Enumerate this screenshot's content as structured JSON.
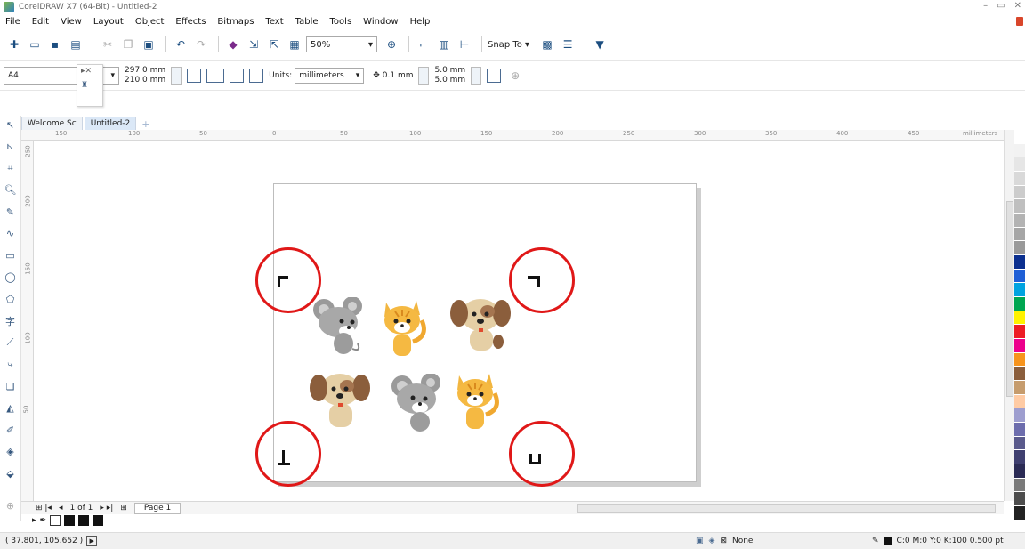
{
  "window": {
    "title": "CorelDRAW X7 (64-Bit) - Untitled-2",
    "controls": [
      "–",
      "▭",
      "✕"
    ]
  },
  "menu": [
    "File",
    "Edit",
    "View",
    "Layout",
    "Object",
    "Effects",
    "Bitmaps",
    "Text",
    "Table",
    "Tools",
    "Window",
    "Help"
  ],
  "toolbar": {
    "zoom": "50%",
    "snap_to": "Snap To"
  },
  "property_bar": {
    "paper": "A4",
    "width": "297.0 mm",
    "height": "210.0 mm",
    "units_label": "Units:",
    "units": "millimeters",
    "nudge": "0.1 mm",
    "dup_x": "5.0 mm",
    "dup_y": "5.0 mm"
  },
  "tabs": [
    "Welcome Sc",
    "Untitled-2"
  ],
  "ruler": {
    "h_labels": [
      "150",
      "100",
      "50",
      "0",
      "50",
      "100",
      "150",
      "200",
      "250",
      "300",
      "350",
      "400",
      "450",
      "millimeters"
    ],
    "v_labels": [
      "250",
      "200",
      "150",
      "100",
      "50"
    ],
    "v_unit": "millimeters"
  },
  "page_nav": {
    "counter": "1 of 1",
    "page_tab": "Page 1"
  },
  "status": {
    "coords": "( 37.801, 105.652 )",
    "fill": "None",
    "outline": "C:0 M:0 Y:0 K:100  0.500 pt"
  },
  "palette_colors": [
    "#ffffff",
    "#f2f2f2",
    "#e6e6e6",
    "#d9d9d9",
    "#cccccc",
    "#bfbfbf",
    "#b3b3b3",
    "#a6a6a6",
    "#999999",
    "#0b2f8f",
    "#1f5fd6",
    "#00a3e0",
    "#00a651",
    "#fff200",
    "#ed1c24",
    "#ec008c",
    "#f7941d",
    "#8b5e3c",
    "#c69c6d",
    "#ffcba4",
    "#9e9ecf",
    "#6d6dad",
    "#5a5a8c",
    "#3f3f70",
    "#2b2b55",
    "#7a7a7a",
    "#4d4d4d",
    "#222222"
  ],
  "accent": "#e01818"
}
